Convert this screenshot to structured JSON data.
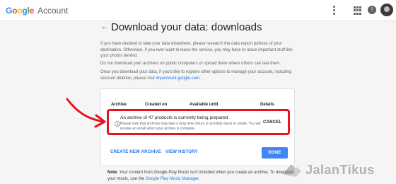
{
  "header": {
    "logo": "Google",
    "product": "Account"
  },
  "page": {
    "back_icon": "←",
    "title": "Download your data: downloads",
    "intro": [
      "If you have decided to take your data elsewhere, please research the data export policies of your destination. Otherwise, if you ever want to leave the service, you may have to leave important stuff like your photos behind.",
      "Do not download your archives on public computers or upload them where others can see them.",
      "Once you download your data, if you'd like to explore other options to manage your account, including account deletion, please visit "
    ],
    "intro_link": "myaccount.google.com."
  },
  "table": {
    "headers": {
      "archive": "Archive",
      "created": "Created on",
      "available": "Available until",
      "details": "Details"
    },
    "row": {
      "title": "An archive of 47 products is currently being prepared",
      "note": "Please note that archives may take a long time (hours or possibly days) to create. You will receive an email when your archive is complete.",
      "cancel": "CANCEL"
    }
  },
  "actions": {
    "create": "CREATE NEW ARCHIVE",
    "history": "VIEW HISTORY",
    "done": "DONE"
  },
  "note": {
    "label": "Note",
    "text": ": Your content from Google Play Music isn't included when you create an archive. To download your music, use the ",
    "link": "Google Play Music Manager."
  },
  "watermark": "JalanTikus",
  "colors": {
    "highlight": "#e3161f",
    "accent": "#4285f4",
    "link": "#1a73e8"
  }
}
